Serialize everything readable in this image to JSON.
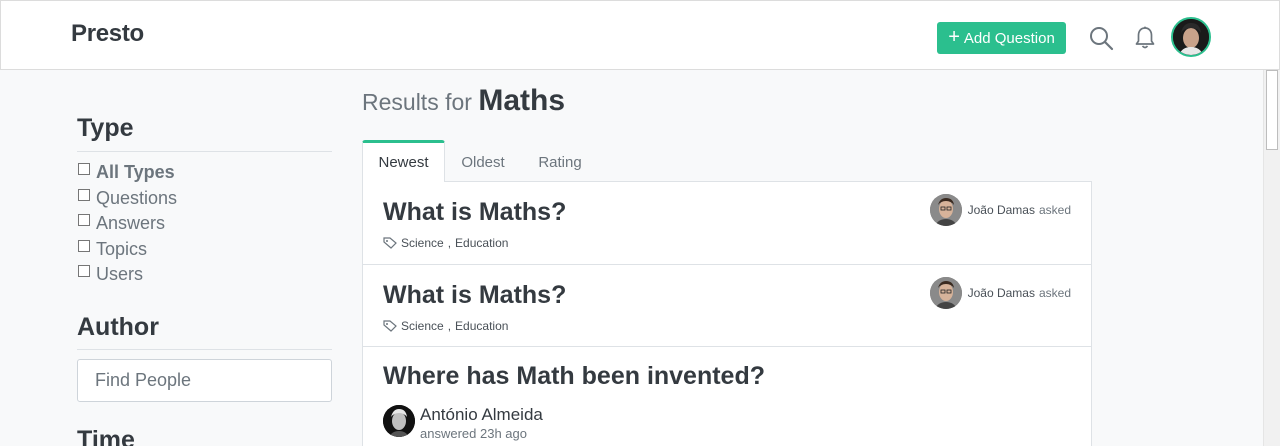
{
  "header": {
    "brand": "Presto",
    "add_button_label": "Add Question",
    "accent_color": "#2bbf8e"
  },
  "sidebar": {
    "type_heading": "Type",
    "type_filters": [
      "All Types",
      "Questions",
      "Answers",
      "Topics",
      "Users"
    ],
    "author_heading": "Author",
    "author_placeholder": "Find People",
    "time_heading": "Time"
  },
  "results": {
    "prefix": "Results for",
    "query": "Maths",
    "tabs": [
      "Newest",
      "Oldest",
      "Rating"
    ],
    "active_tab": "Newest",
    "items": [
      {
        "title": "What is Maths?",
        "tags": [
          "Science",
          "Education"
        ],
        "author": "João Damas",
        "verb": "asked"
      },
      {
        "title": "What is Maths?",
        "tags": [
          "Science",
          "Education"
        ],
        "author": "João Damas",
        "verb": "asked"
      },
      {
        "title": "Where has Math been invented?",
        "answer_author": "António Almeida",
        "answer_time": "answered 23h ago"
      }
    ]
  },
  "icons": [
    "plus-icon",
    "search-icon",
    "bell-icon",
    "tag-icon"
  ]
}
